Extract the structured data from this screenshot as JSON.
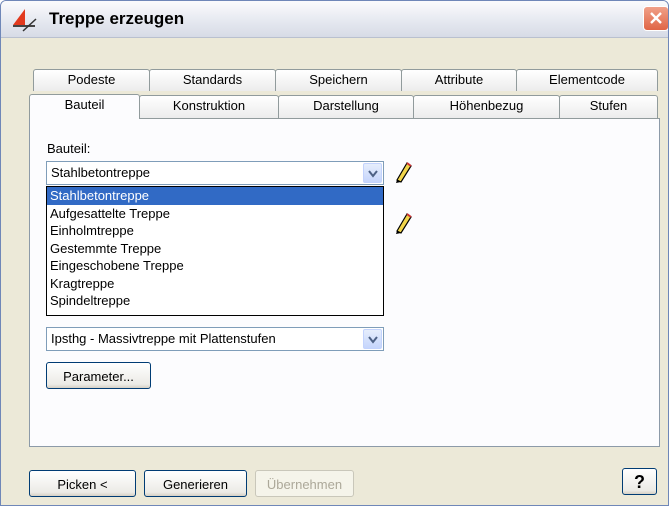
{
  "window": {
    "title": "Treppe erzeugen"
  },
  "tabs_row1": [
    "Podeste",
    "Standards",
    "Speichern",
    "Attribute",
    "Elementcode"
  ],
  "tabs_row2": [
    "Bauteil",
    "Konstruktion",
    "Darstellung",
    "Höhenbezug",
    "Stufen"
  ],
  "active_tab": "Bauteil",
  "panel": {
    "bauteil_label": "Bauteil:",
    "bauteil_value": "Stahlbetontreppe",
    "bauteil_options": [
      "Stahlbetontreppe",
      "Aufgesattelte Treppe",
      "Einholmtreppe",
      "Gestemmte Treppe",
      "Eingeschobene Treppe",
      "Kragtreppe",
      "Spindeltreppe"
    ],
    "type_value": "Ipsthg - Massivtreppe mit Plattenstufen",
    "parameter_button": "Parameter..."
  },
  "buttons": {
    "picken": "Picken <",
    "generieren": "Generieren",
    "uebernehmen": "Übernehmen",
    "help": "?"
  },
  "colors": {
    "selection": "#316ac5",
    "tab_border": "#919b9c",
    "close": "#e06546"
  },
  "icons": {
    "app": "stair-app-icon",
    "close": "close-icon",
    "edit": "pencil-icon",
    "dropdown": "chevron-down-icon"
  }
}
